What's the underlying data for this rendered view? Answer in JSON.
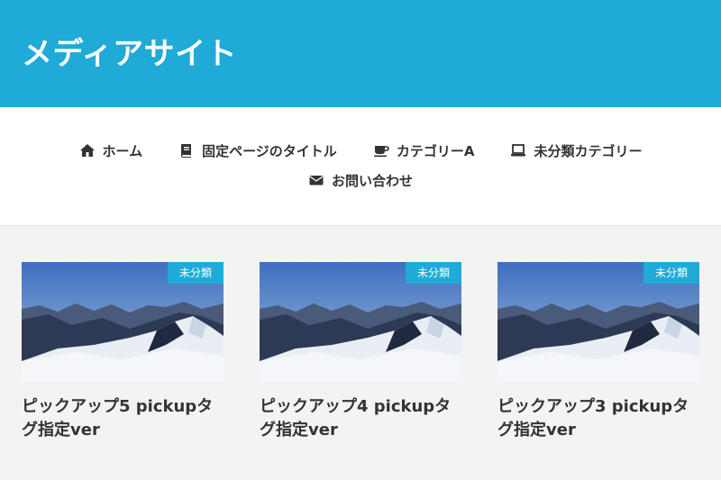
{
  "site": {
    "title": "メディアサイト"
  },
  "colors": {
    "brand": "#1faad8",
    "text": "#333333",
    "background": "#f3f3f3"
  },
  "nav": {
    "items": [
      {
        "label": "ホーム",
        "icon": "home-icon"
      },
      {
        "label": "固定ページのタイトル",
        "icon": "book-icon"
      },
      {
        "label": "カテゴリーA",
        "icon": "coffee-icon"
      },
      {
        "label": "未分類カテゴリー",
        "icon": "laptop-icon"
      },
      {
        "label": "お問い合わせ",
        "icon": "envelope-icon"
      }
    ]
  },
  "posts": [
    {
      "category": "未分類",
      "title": "ピックアップ5 pickupタグ指定ver"
    },
    {
      "category": "未分類",
      "title": "ピックアップ4 pickupタグ指定ver"
    },
    {
      "category": "未分類",
      "title": "ピックアップ3 pickupタグ指定ver"
    }
  ]
}
